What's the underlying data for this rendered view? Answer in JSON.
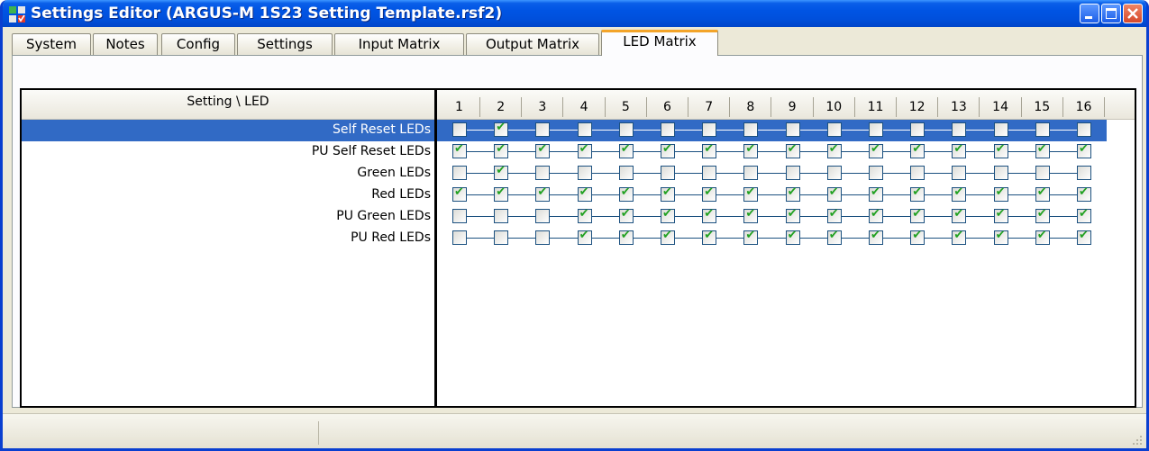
{
  "window": {
    "title": "Settings Editor (ARGUS-M 1S23 Setting Template.rsf2)"
  },
  "tabs": [
    "System",
    "Notes",
    "Config",
    "Settings",
    "Input Matrix",
    "Output Matrix",
    "LED Matrix"
  ],
  "active_tab": "LED Matrix",
  "matrix": {
    "row_header": "Setting \\ LED",
    "columns": [
      "1",
      "2",
      "3",
      "4",
      "5",
      "6",
      "7",
      "8",
      "9",
      "10",
      "11",
      "12",
      "13",
      "14",
      "15",
      "16"
    ],
    "rows": [
      {
        "label": "Self Reset LEDs",
        "checked": [
          0,
          1,
          0,
          0,
          0,
          0,
          0,
          0,
          0,
          0,
          0,
          0,
          0,
          0,
          0,
          0
        ]
      },
      {
        "label": "PU Self Reset LEDs",
        "checked": [
          1,
          1,
          1,
          1,
          1,
          1,
          1,
          1,
          1,
          1,
          1,
          1,
          1,
          1,
          1,
          1
        ]
      },
      {
        "label": "Green LEDs",
        "checked": [
          0,
          1,
          0,
          0,
          0,
          0,
          0,
          0,
          0,
          0,
          0,
          0,
          0,
          0,
          0,
          0
        ]
      },
      {
        "label": "Red LEDs",
        "checked": [
          1,
          1,
          1,
          1,
          1,
          1,
          1,
          1,
          1,
          1,
          1,
          1,
          1,
          1,
          1,
          1
        ]
      },
      {
        "label": "PU Green LEDs",
        "checked": [
          0,
          0,
          0,
          1,
          1,
          1,
          1,
          1,
          1,
          1,
          1,
          1,
          1,
          1,
          1,
          1
        ]
      },
      {
        "label": "PU Red LEDs",
        "checked": [
          0,
          0,
          0,
          1,
          1,
          1,
          1,
          1,
          1,
          1,
          1,
          1,
          1,
          1,
          1,
          1
        ]
      }
    ],
    "selected_row": "Self Reset LEDs"
  },
  "colors": {
    "title_bar": "#0054e3",
    "selection": "#316ac5",
    "active_tab_accent": "#f3a429",
    "check": "#21a121"
  }
}
